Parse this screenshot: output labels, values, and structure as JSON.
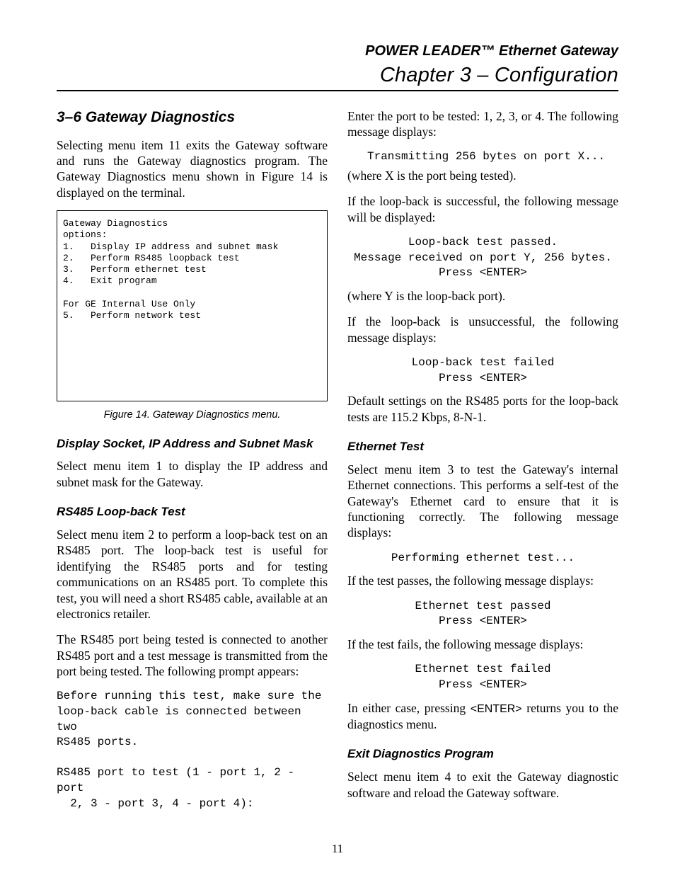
{
  "header": {
    "product": "POWER LEADER™ Ethernet Gateway",
    "chapter": "Chapter 3 – Configuration"
  },
  "left": {
    "h2": "3–6 Gateway Diagnostics",
    "p1": "Selecting menu item 11 exits the Gateway software and runs the Gateway diagnostics program. The Gateway Diagnostics menu shown in Figure 14 is displayed on the terminal.",
    "figbox": "Gateway Diagnostics\noptions:\n1.   Display IP address and subnet mask\n2.   Perform RS485 loopback test\n3.   Perform ethernet test\n4.   Exit program\n\nFor GE Internal Use Only\n5.   Perform network test",
    "caption": "Figure 14. Gateway Diagnostics menu.",
    "h3a": "Display Socket, IP Address and Subnet Mask",
    "p2": "Select menu item 1 to display the IP address and subnet mask for the Gateway.",
    "h3b": "RS485 Loop-back Test",
    "p3": "Select menu item 2 to perform a loop-back test on an RS485 port. The loop-back test is useful for identifying the RS485 ports and for testing communications on an RS485 port. To complete this test, you will need a short RS485 cable, available at an electronics retailer.",
    "p4": "The RS485 port being tested is connected to another RS485 port and a test message is transmitted from the port being tested. The following prompt appears:",
    "code1": "Before running this test, make sure the\nloop-back cable is connected between two\nRS485 ports.\n\nRS485 port to test (1 - port 1, 2 - port\n  2, 3 - port 3, 4 - port 4):"
  },
  "right": {
    "p1": "Enter the port to be tested: 1, 2, 3, or 4. The following message displays:",
    "code1": "Transmitting 256 bytes on port X...",
    "p2": "(where X is the port being tested).",
    "p3": "If the loop-back is successful, the following message will be displayed:",
    "code2": "Loop-back test passed.\nMessage received on port Y, 256 bytes.\nPress <ENTER>",
    "p4": "(where Y is the loop-back port).",
    "p5": "If the loop-back is unsuccessful, the following message displays:",
    "code3": "Loop-back test failed\nPress <ENTER>",
    "p6": "Default settings on the RS485 ports for the loop-back tests are 115.2 Kbps, 8-N-1.",
    "h3a": "Ethernet Test",
    "p7": "Select menu item 3 to test the Gateway's internal Ethernet connections. This performs a self-test of the Gateway's Ethernet card to ensure that it is functioning correctly. The following message displays:",
    "code4": "Performing ethernet test...",
    "p8": "If the test passes, the following message displays:",
    "code5": "Ethernet test passed\nPress <ENTER>",
    "p9": "If the test fails, the following message displays:",
    "code6": "Ethernet test failed\nPress <ENTER>",
    "p10a": "In either case, pressing ",
    "p10enter": "<ENTER>",
    "p10b": " returns you to the diagnostics menu.",
    "h3b": "Exit Diagnostics Program",
    "p11": "Select menu item 4 to exit the Gateway diagnostic software and reload the Gateway software."
  },
  "pageno": "11"
}
